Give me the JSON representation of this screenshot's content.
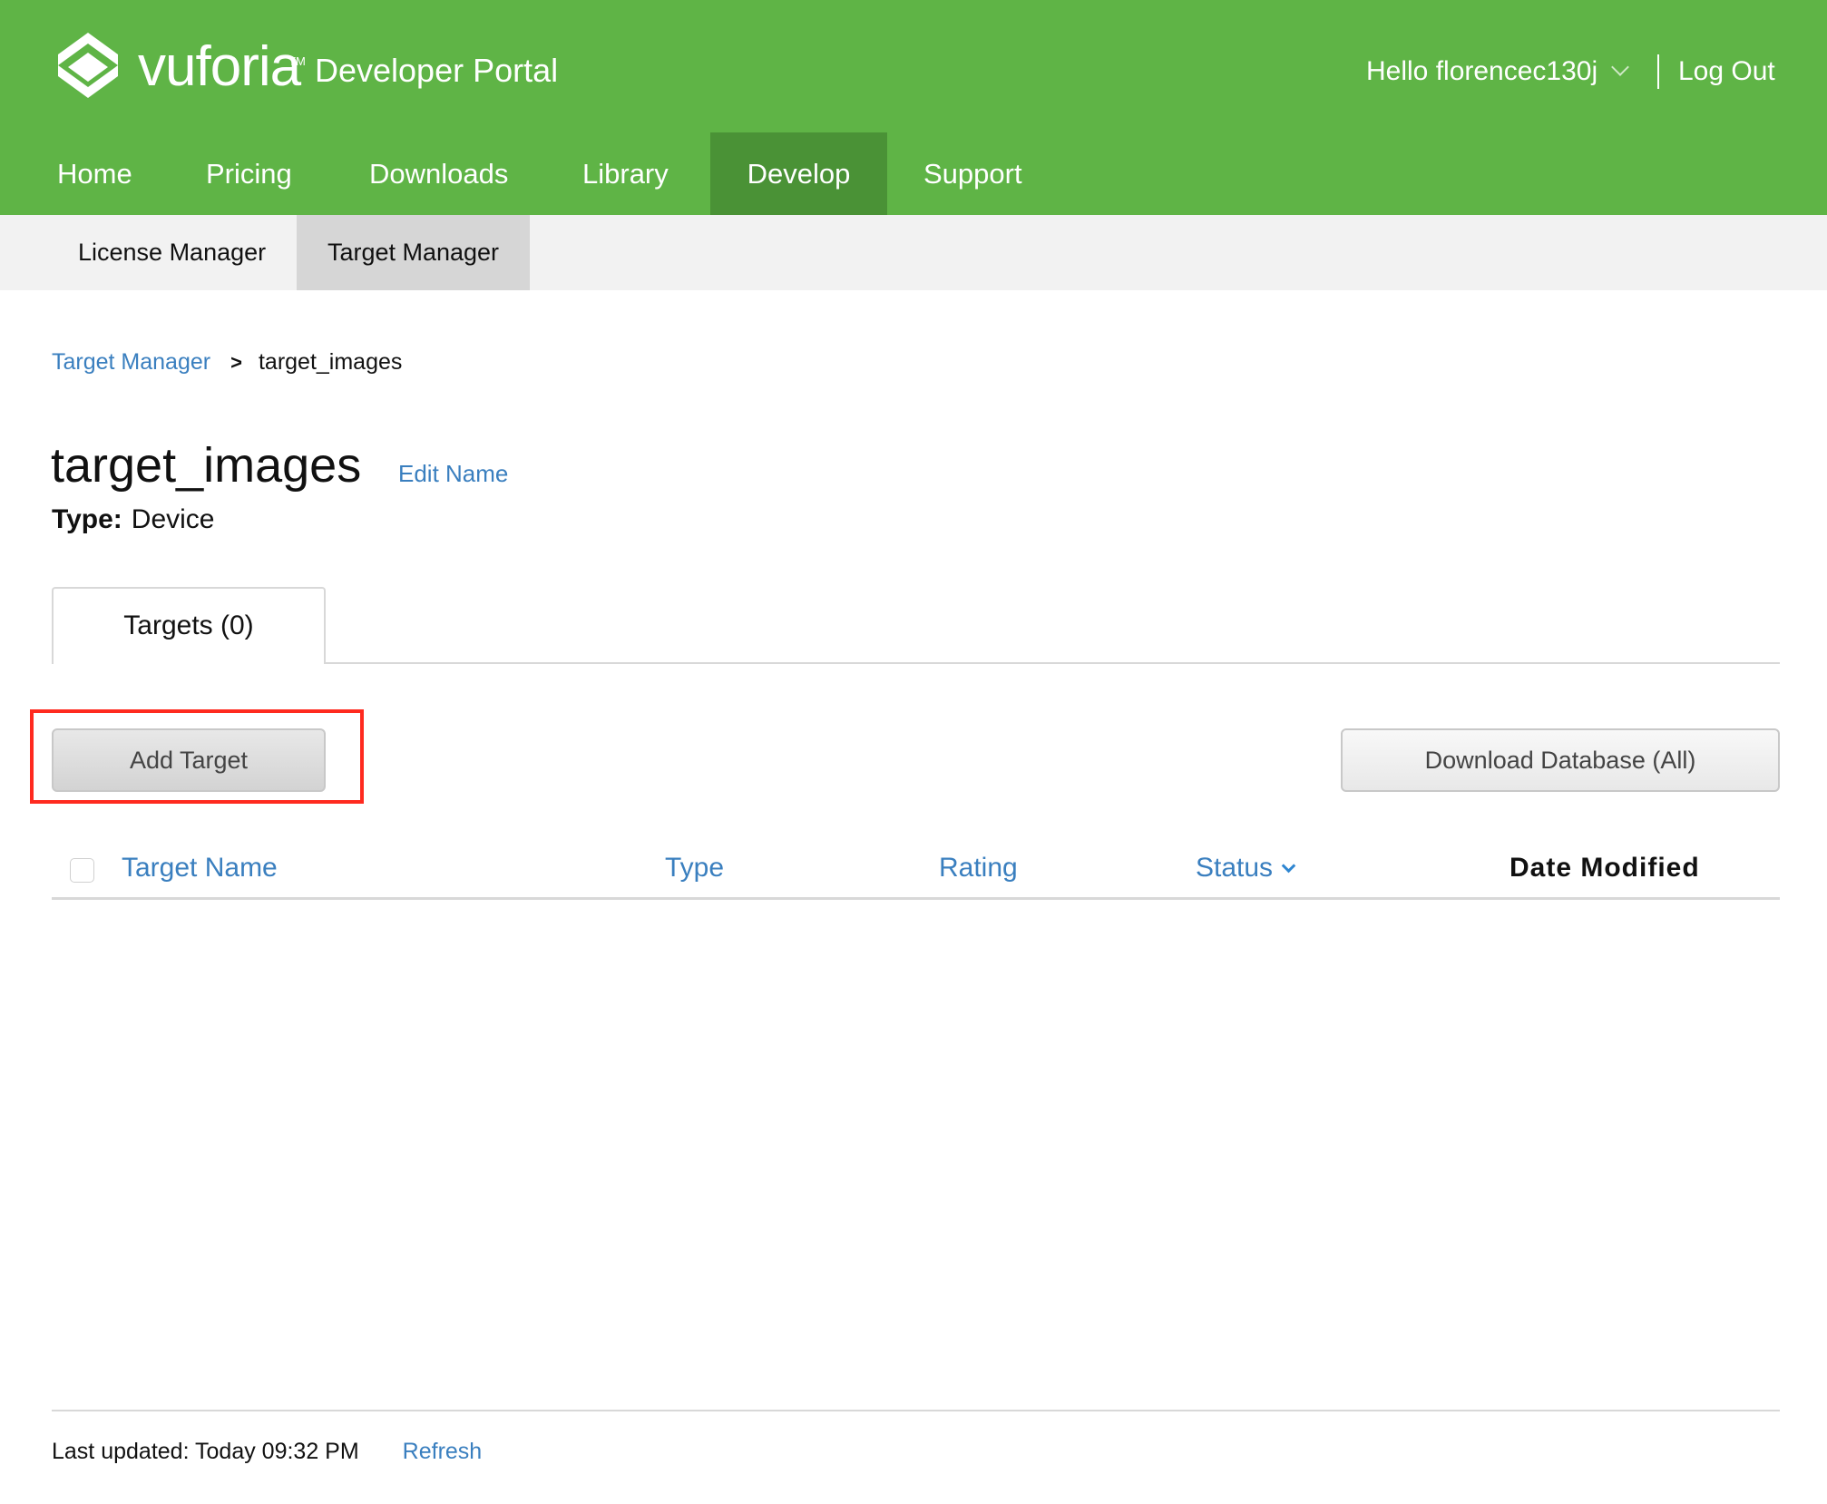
{
  "header": {
    "brand": "vuforia",
    "trademark": "TM",
    "portal": "Developer Portal",
    "user_greeting": "Hello florencec130j",
    "logout": "Log Out",
    "colors": {
      "header_bg": "#5fb446",
      "active_tab_bg": "#4a9236"
    }
  },
  "nav": {
    "items": [
      {
        "label": "Home"
      },
      {
        "label": "Pricing"
      },
      {
        "label": "Downloads"
      },
      {
        "label": "Library"
      },
      {
        "label": "Develop",
        "active": true
      },
      {
        "label": "Support"
      }
    ]
  },
  "subnav": {
    "items": [
      {
        "label": "License Manager"
      },
      {
        "label": "Target Manager",
        "active": true
      }
    ]
  },
  "breadcrumb": {
    "parent": "Target Manager",
    "separator": ">",
    "current": "target_images"
  },
  "database": {
    "name": "target_images",
    "edit_label": "Edit Name",
    "type_label": "Type:",
    "type_value": "Device"
  },
  "tabs": [
    {
      "label": "Targets (0)",
      "active": true
    }
  ],
  "actions": {
    "add_target": "Add Target",
    "download_database": "Download Database (All)"
  },
  "table": {
    "columns": [
      {
        "label": "Target Name",
        "sortable": true
      },
      {
        "label": "Type",
        "sortable": true
      },
      {
        "label": "Rating",
        "sortable": true
      },
      {
        "label": "Status",
        "sortable": true,
        "icon": "chevron-down-icon"
      },
      {
        "label": "Date Modified",
        "sortable": false
      }
    ],
    "rows": []
  },
  "footer": {
    "last_updated": "Last updated: Today 09:32 PM",
    "refresh": "Refresh"
  }
}
